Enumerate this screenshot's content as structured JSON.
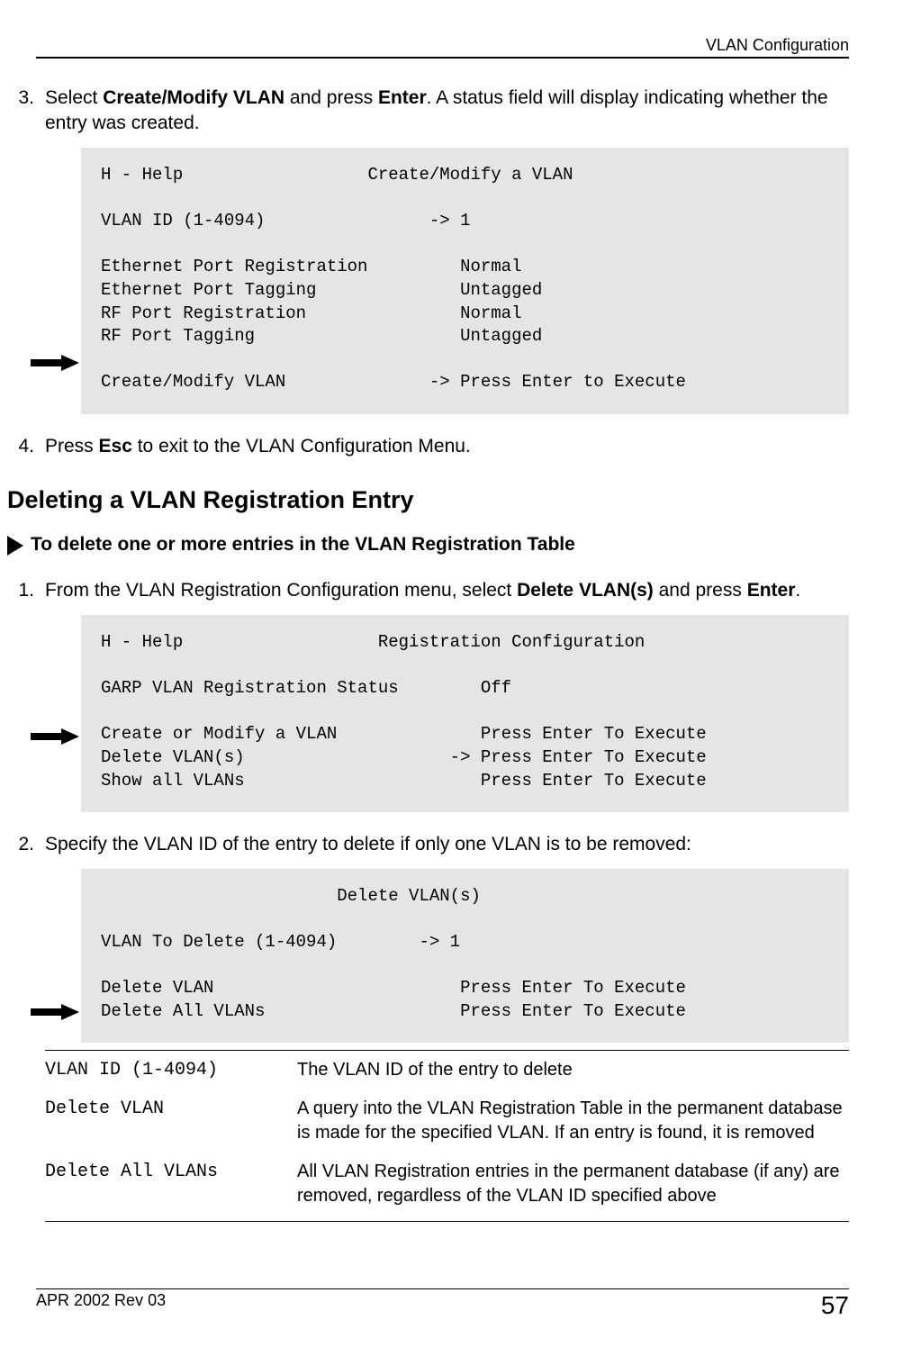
{
  "header": {
    "running_title": "VLAN Configuration"
  },
  "steps": {
    "s3_num": "3.",
    "s3_a": "Select ",
    "s3_b": "Create/Modify VLAN",
    "s3_c": " and press ",
    "s3_d": "Enter",
    "s3_e": ". A status field will display indicating whether the entry was created.",
    "s4_num": "4.",
    "s4_a": "Press ",
    "s4_b": "Esc",
    "s4_c": " to exit to the VLAN Configuration Menu.",
    "s1_num": "1.",
    "s1_a": "From the VLAN Registration Configuration menu, select ",
    "s1_b": "Delete VLAN(s)",
    "s1_c": "  and press ",
    "s1_d": "Enter",
    "s1_e": ".",
    "s2_num": "2.",
    "s2_a": "Specify the VLAN ID of the entry to delete if only one VLAN is to be removed:"
  },
  "section_heading": "Deleting a VLAN Registration Entry",
  "procedure_title": "To delete one or more entries in the VLAN Registration Table",
  "code1": "H - Help                  Create/Modify a VLAN\n\nVLAN ID (1-4094)                -> 1\n\nEthernet Port Registration         Normal\nEthernet Port Tagging              Untagged\nRF Port Registration               Normal\nRF Port Tagging                    Untagged\n\nCreate/Modify VLAN              -> Press Enter to Execute",
  "code2": "H - Help                   Registration Configuration\n\nGARP VLAN Registration Status        Off\n\nCreate or Modify a VLAN              Press Enter To Execute\nDelete VLAN(s)                    -> Press Enter To Execute\nShow all VLANs                       Press Enter To Execute",
  "code3": "                       Delete VLAN(s)\n\nVLAN To Delete (1-4094)        -> 1\n\nDelete VLAN                        Press Enter To Execute\nDelete All VLANs                   Press Enter To Execute",
  "defs": [
    {
      "term": "VLAN ID (1-4094)",
      "desc": "The VLAN ID of the entry to delete"
    },
    {
      "term": "Delete VLAN",
      "desc": "A query into the VLAN Registration Table in the permanent database is made for the specified VLAN. If an entry is found, it is removed"
    },
    {
      "term": "Delete All VLANs",
      "desc": "All VLAN Registration entries in the permanent database (if any) are removed, regardless of the VLAN ID specified above"
    }
  ],
  "footer": {
    "rev": "APR 2002 Rev 03",
    "page": "57"
  }
}
